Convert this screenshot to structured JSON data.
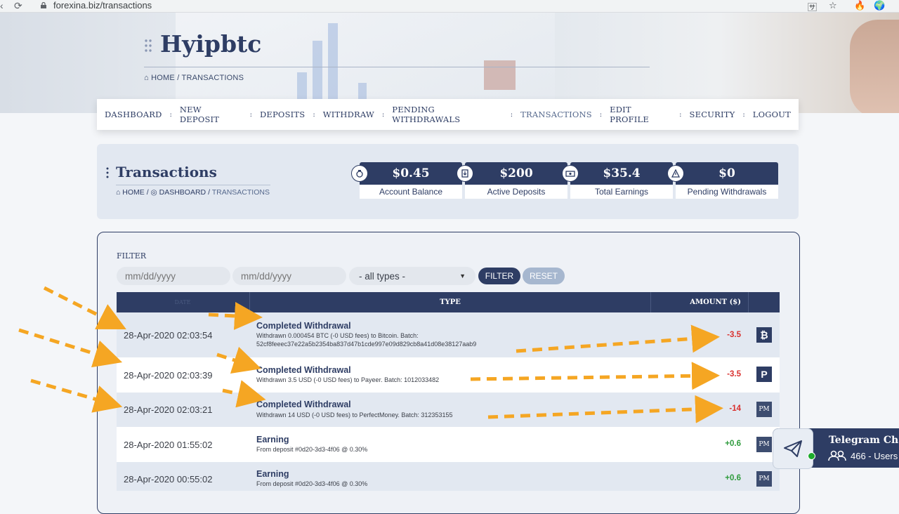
{
  "browser": {
    "url": "forexina.biz/transactions"
  },
  "site": {
    "logo": "Hyipbtc",
    "hero_breadcrumb": {
      "home": "HOME",
      "sep": "/",
      "current": "TRANSACTIONS"
    }
  },
  "nav": {
    "items": [
      "DASHBOARD",
      "NEW DEPOSIT",
      "DEPOSITS",
      "WITHDRAW",
      "PENDING WITHDRAWALS",
      "TRANSACTIONS",
      "EDIT PROFILE",
      "SECURITY",
      "LOGOUT"
    ],
    "active": "TRANSACTIONS",
    "separator": ":"
  },
  "page": {
    "title": "Transactions",
    "breadcrumb": {
      "home": "HOME",
      "dashboard": "DASHBOARD",
      "current": "TRANSACTIONS",
      "sep": "/"
    }
  },
  "stats": [
    {
      "value": "$0.45",
      "label": "Account Balance",
      "icon": "piggy-bank-icon"
    },
    {
      "value": "$200",
      "label": "Active Deposits",
      "icon": "deposit-icon"
    },
    {
      "value": "$35.4",
      "label": "Total Earnings",
      "icon": "money-icon"
    },
    {
      "value": "$0",
      "label": "Pending Withdrawals",
      "icon": "warning-icon"
    }
  ],
  "filter": {
    "label": "FILTER",
    "date_from_placeholder": "mm/dd/yyyy",
    "date_to_placeholder": "mm/dd/yyyy",
    "type_selected": "- all types -",
    "filter_button": "FILTER",
    "reset_button": "RESET"
  },
  "table": {
    "headers": {
      "date": "DATE",
      "type": "TYPE",
      "amount": "AMOUNT ($)"
    },
    "rows": [
      {
        "date": "28-Apr-2020 02:03:54",
        "title": "Completed Withdrawal",
        "desc": "Withdrawn 0.000454 BTC (-0 USD fees) to Bitcoin. Batch: 52cf8feeec37e22a5b2354ba837d47b1cde997e09d829cb8a41d08e38127aab9",
        "amount": "-3.5",
        "sign": "neg",
        "method": "bitcoin-icon",
        "method_label": "₿"
      },
      {
        "date": "28-Apr-2020 02:03:39",
        "title": "Completed Withdrawal",
        "desc": "Withdrawn 3.5 USD (-0 USD fees) to Payeer. Batch: 1012033482",
        "amount": "-3.5",
        "sign": "neg",
        "method": "payeer-icon",
        "method_label": "P"
      },
      {
        "date": "28-Apr-2020 02:03:21",
        "title": "Completed Withdrawal",
        "desc": "Withdrawn 14 USD (-0 USD fees) to PerfectMoney. Batch: 312353155",
        "amount": "-14",
        "sign": "neg",
        "method": "perfectmoney-icon",
        "method_label": "PM"
      },
      {
        "date": "28-Apr-2020 01:55:02",
        "title": "Earning",
        "desc": "From deposit #0d20-3d3-4f06 @ 0.30%",
        "amount": "+0.6",
        "sign": "pos",
        "method": "perfectmoney-icon",
        "method_label": "PM"
      },
      {
        "date": "28-Apr-2020 00:55:02",
        "title": "Earning",
        "desc": "From deposit #0d20-3d3-4f06 @ 0.30%",
        "amount": "+0.6",
        "sign": "pos",
        "method": "perfectmoney-icon",
        "method_label": "PM"
      }
    ]
  },
  "telegram": {
    "title": "Telegram Chat",
    "users": "466 - Users"
  },
  "colors": {
    "primary": "#2e3d64",
    "negative": "#d9302e",
    "positive": "#2e9b3c",
    "annotation": "#f5a623"
  }
}
